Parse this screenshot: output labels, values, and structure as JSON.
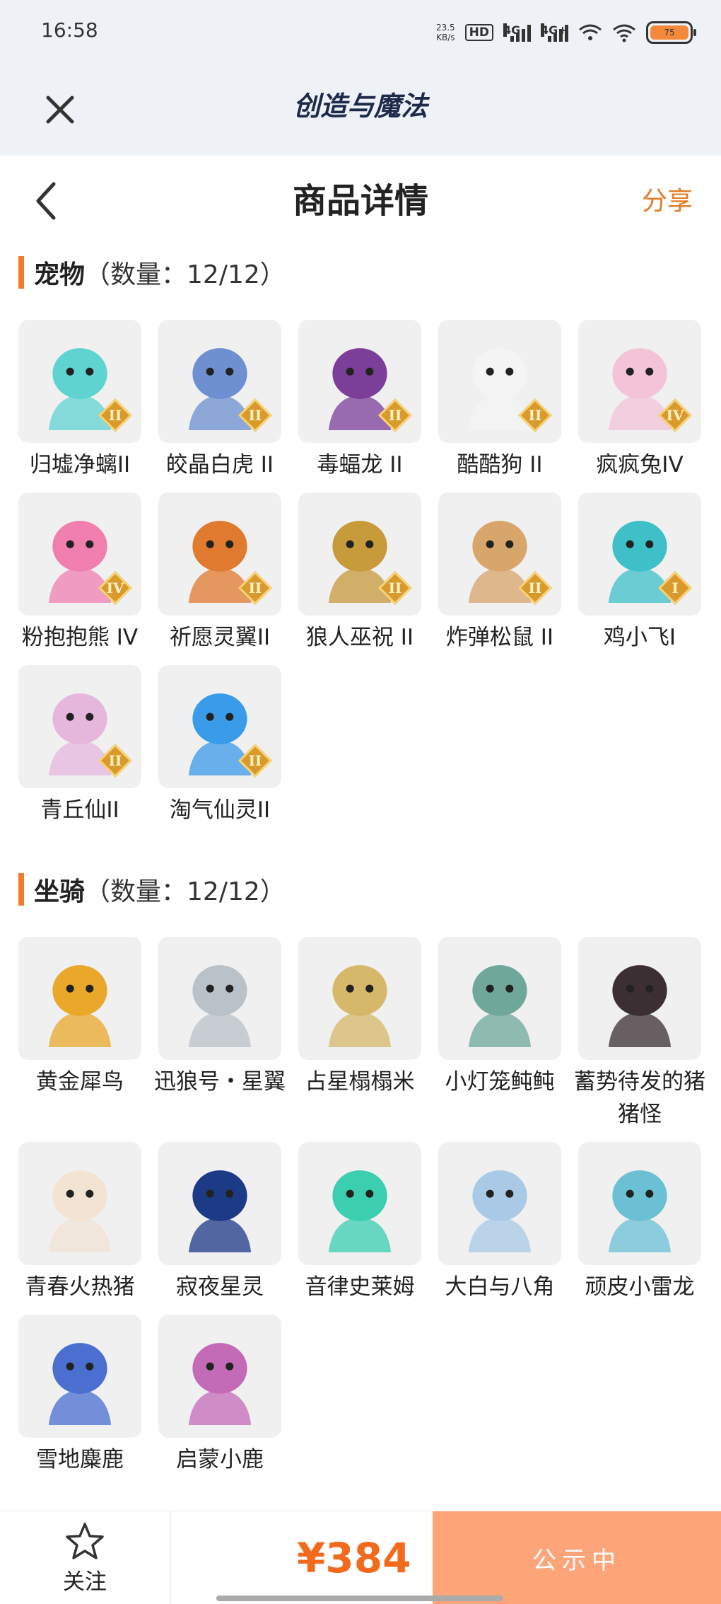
{
  "status_bar": {
    "time": "16:58",
    "net_speed_value": "23.5",
    "net_speed_unit": "KB/s",
    "hd_badge": "HD",
    "sig1_label": "4G",
    "sig2_label": "4G+",
    "battery": "75"
  },
  "header": {
    "app_title": "创造与魔法"
  },
  "nav": {
    "title": "商品详情",
    "share": "分享"
  },
  "pets": {
    "title": "宠物",
    "count": "（数量：12/12）",
    "items": [
      {
        "name": "归墟净螭II",
        "tier": "II",
        "color": "#5fd3cf"
      },
      {
        "name": "皎晶白虎 II",
        "tier": "II",
        "color": "#6e8fd0"
      },
      {
        "name": "毒蝠龙 II",
        "tier": "II",
        "color": "#7b3f9a"
      },
      {
        "name": "酷酷狗 II",
        "tier": "II",
        "color": "#f4f4f4"
      },
      {
        "name": "疯疯兔IV",
        "tier": "IV",
        "color": "#f3c4d8"
      },
      {
        "name": "粉抱抱熊 IV",
        "tier": "IV",
        "color": "#f07fb0"
      },
      {
        "name": "祈愿灵翼II",
        "tier": "II",
        "color": "#e07a2e"
      },
      {
        "name": "狼人巫祝 II",
        "tier": "II",
        "color": "#c79a3a"
      },
      {
        "name": "炸弹松鼠 II",
        "tier": "II",
        "color": "#d8a66a"
      },
      {
        "name": "鸡小飞I",
        "tier": "I",
        "color": "#3fc0c8"
      },
      {
        "name": "青丘仙II",
        "tier": "II",
        "color": "#e6b7dc"
      },
      {
        "name": "淘气仙灵II",
        "tier": "II",
        "color": "#3a9be8"
      }
    ]
  },
  "mounts": {
    "title": "坐骑",
    "count": "（数量：12/12）",
    "items": [
      {
        "name": "黄金犀鸟",
        "color": "#e9a829"
      },
      {
        "name": "迅狼号・星翼",
        "color": "#b9c2c8"
      },
      {
        "name": "占星榻榻米",
        "color": "#d6b86a"
      },
      {
        "name": "小灯笼鲀鲀",
        "color": "#6fa89a"
      },
      {
        "name": "蓄势待发的猪猪怪",
        "color": "#3b2f33"
      },
      {
        "name": "青春火热猪",
        "color": "#f2e3d3"
      },
      {
        "name": "寂夜星灵",
        "color": "#1d3a86"
      },
      {
        "name": "音律史莱姆",
        "color": "#3bcfb0"
      },
      {
        "name": "大白与八角",
        "color": "#a9c9e6"
      },
      {
        "name": "顽皮小雷龙",
        "color": "#6cc0d4"
      },
      {
        "name": "雪地麋鹿",
        "color": "#4a6fd1"
      },
      {
        "name": "启蒙小鹿",
        "color": "#c46bb8"
      }
    ]
  },
  "bottom": {
    "follow": "关注",
    "price": "¥384",
    "status": "公示中"
  }
}
